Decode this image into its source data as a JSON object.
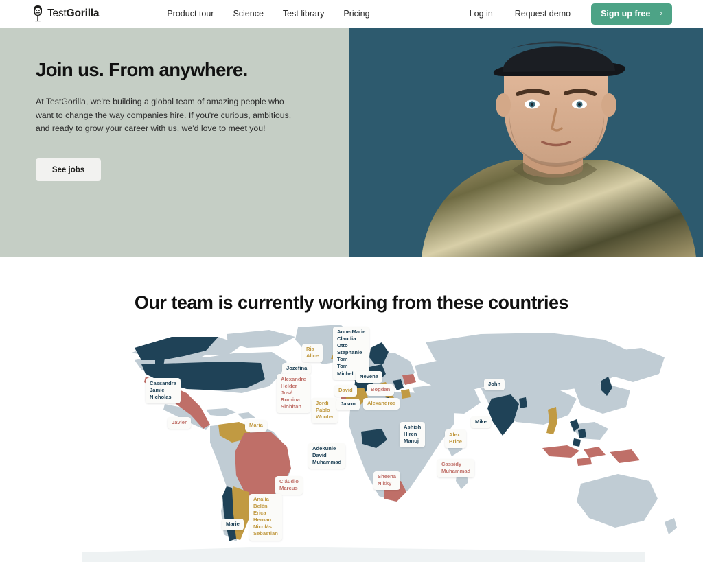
{
  "header": {
    "logo": {
      "icon": "gorilla-logo-icon",
      "text_light": "Test",
      "text_bold": "Gorilla"
    },
    "nav_main": [
      {
        "label": "Product tour"
      },
      {
        "label": "Science"
      },
      {
        "label": "Test library"
      },
      {
        "label": "Pricing"
      }
    ],
    "nav_right": [
      {
        "label": "Log in"
      },
      {
        "label": "Request demo"
      }
    ],
    "signup_button": {
      "label": "Sign up free",
      "chevron": "›",
      "color": "#4da386"
    }
  },
  "hero": {
    "title": "Join us. From anywhere.",
    "body": "At TestGorilla, we're building a global team of amazing people who want to change the way companies hire. If you're curious, ambitious, and ready to grow your career with us, we'd love to meet you!",
    "cta_label": "See jobs",
    "left_bg": "#c5cec5",
    "right_bg": "#2d5a6e",
    "photo_alt": "portrait-photo"
  },
  "map_section": {
    "title": "Our team is currently working from these countries",
    "colors": {
      "navy": "#1f4257",
      "rose": "#bf6f68",
      "gold": "#c19a42",
      "land": "#c0ccd4",
      "ocean": "#ffffff"
    },
    "labels": [
      {
        "id": "canada",
        "color": "navy",
        "names": [
          "Cassandra",
          "Jamie",
          "Nicholas"
        ]
      },
      {
        "id": "mexico",
        "color": "rose",
        "names": [
          "Javier"
        ]
      },
      {
        "id": "venezuela",
        "color": "gold",
        "names": [
          "Maria"
        ]
      },
      {
        "id": "iceland",
        "color": "gold",
        "names": [
          "Ria",
          "Alice"
        ]
      },
      {
        "id": "ireland",
        "color": "navy",
        "names": [
          "Jozefina"
        ]
      },
      {
        "id": "nordics",
        "color": "navy",
        "names": [
          "Anne-Marie",
          "Claudia",
          "Otto",
          "Stephanie",
          "Tom",
          "Tom",
          "Michel"
        ]
      },
      {
        "id": "portugal",
        "color": "rose",
        "names": [
          "Alexandre",
          "Hélder",
          "José",
          "Romina",
          "Siobhan"
        ]
      },
      {
        "id": "spain",
        "color": "gold",
        "names": [
          "Jordi",
          "Pablo",
          "Wouter"
        ]
      },
      {
        "id": "italy",
        "color": "gold",
        "names": [
          "David"
        ]
      },
      {
        "id": "serbia",
        "color": "navy",
        "names": [
          "Nevena"
        ]
      },
      {
        "id": "romania",
        "color": "rose",
        "names": [
          "Bogdan"
        ]
      },
      {
        "id": "tunisia",
        "color": "navy",
        "names": [
          "Jason"
        ]
      },
      {
        "id": "greece",
        "color": "gold",
        "names": [
          "Alexandros"
        ]
      },
      {
        "id": "nigeria",
        "color": "navy",
        "names": [
          "Adekunle",
          "David",
          "Muhammad"
        ]
      },
      {
        "id": "southafrica",
        "color": "rose",
        "names": [
          "Sheena",
          "Nikky"
        ]
      },
      {
        "id": "brazil",
        "color": "rose",
        "names": [
          "Cláudio",
          "Marcus"
        ]
      },
      {
        "id": "argentina",
        "color": "gold",
        "names": [
          "Analía",
          "Belén",
          "Erica",
          "Hernan",
          "Nicolás",
          "Sebastian"
        ]
      },
      {
        "id": "chile",
        "color": "navy",
        "names": [
          "Marie"
        ]
      },
      {
        "id": "india",
        "color": "navy",
        "names": [
          "Ashish",
          "Hiren",
          "Manoj"
        ]
      },
      {
        "id": "vietnam",
        "color": "gold",
        "names": [
          "Alex",
          "Brice"
        ]
      },
      {
        "id": "philippines",
        "color": "navy",
        "names": [
          "Mike"
        ]
      },
      {
        "id": "japan",
        "color": "navy",
        "names": [
          "John"
        ]
      },
      {
        "id": "indonesia",
        "color": "rose",
        "names": [
          "Cassidy",
          "Muhammad"
        ]
      }
    ]
  }
}
